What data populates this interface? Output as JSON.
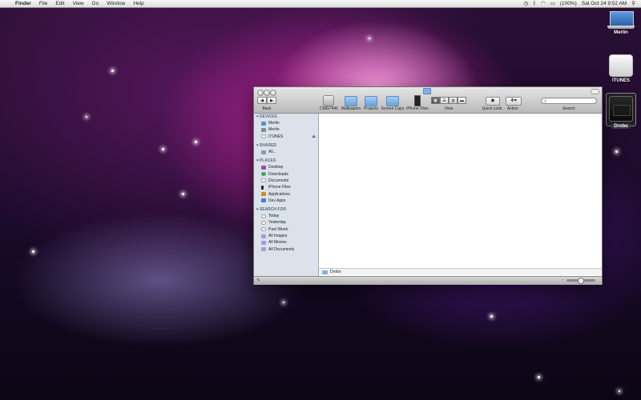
{
  "menubar": {
    "apple": "",
    "items": [
      "Finder",
      "File",
      "Edit",
      "View",
      "Go",
      "Window",
      "Help"
    ],
    "battery": "(100%)",
    "datetime": "Sat Oct 24  9:52 AM"
  },
  "desktop_icons": [
    {
      "label": "Merlin"
    },
    {
      "label": "ITUNES"
    },
    {
      "label": "Drobo"
    }
  ],
  "toolbar": {
    "back_label": "Back",
    "items": [
      "CMG7445",
      "Wallpapers",
      "Projects",
      "Screen Caps",
      "iPhone Files"
    ],
    "view_label": "View",
    "quicklook_label": "Quick Look",
    "action_label": "Action",
    "search_label": "Search",
    "search_placeholder": ""
  },
  "sidebar": {
    "devices": {
      "header": "DEVICES",
      "items": [
        "Merlin",
        "Merlin",
        "ITUNES"
      ]
    },
    "shared": {
      "header": "SHARED",
      "items": [
        "All..."
      ]
    },
    "places": {
      "header": "PLACES",
      "items": [
        "Desktop",
        "Downloads",
        "Documents",
        "iPhone Files",
        "Applications",
        "Dev Apps"
      ]
    },
    "search": {
      "header": "SEARCH FOR",
      "items": [
        "Today",
        "Yesterday",
        "Past Week",
        "All Images",
        "All Movies",
        "All Documents"
      ]
    }
  },
  "pathbar": {
    "label": "Drobo"
  }
}
